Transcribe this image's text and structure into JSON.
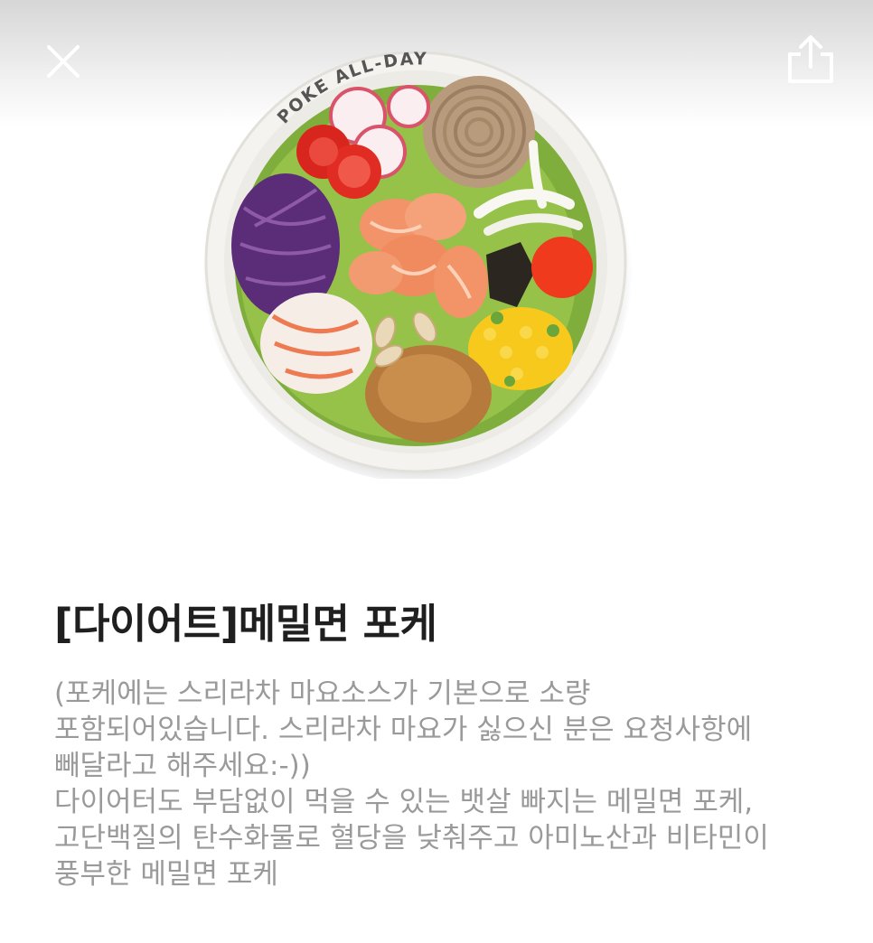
{
  "header": {
    "close_icon": "close-icon",
    "share_icon": "share-icon"
  },
  "hero": {
    "bowl_brand_text": "POKE ALL-DAY"
  },
  "product": {
    "title": "[다이어트]메밀면 포케",
    "description_lines": [
      "(포케에는 스리라차 마요소스가 기본으로 소량",
      "포함되어있습니다. 스리라차 마요가 싫으신 분은 요청사항에",
      "빼달라고 해주세요:-))",
      "다이어터도 부담없이 먹을 수 있는 뱃살 빠지는 메밀면 포케,",
      "고단백질의 탄수화물로 혈당을 낮춰주고 아미노산과 비타민이",
      "풍부한 메밀면 포케"
    ]
  },
  "colors": {
    "title": "#1f1f1f",
    "description": "#9a9a9a"
  }
}
